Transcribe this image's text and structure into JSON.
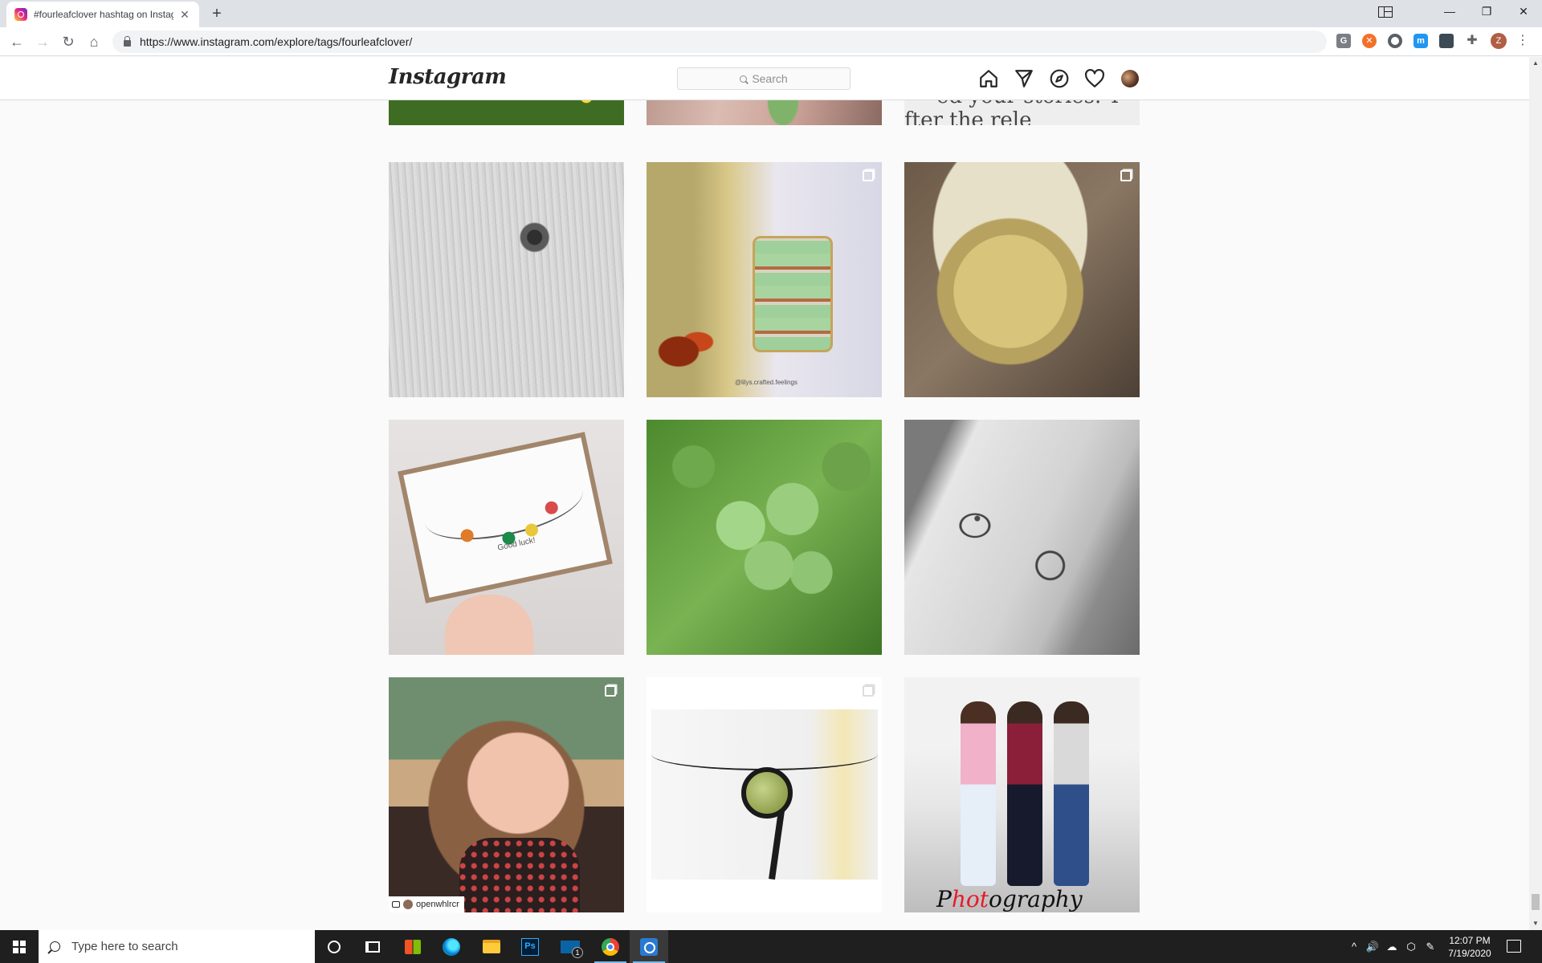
{
  "browser": {
    "tab_title": "#fourleafclover hashtag on Instagram",
    "tab_close_glyph": "✕",
    "new_tab_glyph": "+",
    "url": "https://www.instagram.com/explore/tags/fourleafclover/",
    "profile_initial": "Z",
    "extensions": [
      "grammarly-icon",
      "orange-x-icon",
      "circle-icon",
      "m-icon",
      "mobile-icon",
      "puzzle-icon"
    ],
    "window_controls": {
      "minimize": "—",
      "restore": "❐",
      "close": "✕"
    },
    "nav_glyphs": {
      "back": "←",
      "forward": "→",
      "reload": "↻",
      "home": "⌂",
      "menu": "⋮"
    }
  },
  "instagram": {
    "logo": "Instagram",
    "search_placeholder": "Search",
    "nav_icons": [
      "home-icon",
      "direct-icon",
      "explore-icon",
      "activity-heart-icon",
      "profile-avatar"
    ]
  },
  "posts": [
    {
      "row": 0,
      "col": 0,
      "subject": "yellow flowers in clover",
      "multi": false
    },
    {
      "row": 0,
      "col": 1,
      "subject": "hand holding clover",
      "multi": false
    },
    {
      "row": 0,
      "col": 2,
      "subject": "text post",
      "text_lines": [
        "ed your stories. T",
        "fter the rele"
      ],
      "multi": false
    },
    {
      "row": 1,
      "col": 0,
      "subject": "black and white clover on wood",
      "multi": false
    },
    {
      "row": 1,
      "col": 1,
      "subject": "decorated glass jar",
      "caption": "@lilys.crafted.feelings",
      "multi": true
    },
    {
      "row": 1,
      "col": 2,
      "subject": "glass mug of tea",
      "multi": true
    },
    {
      "row": 2,
      "col": 0,
      "subject": "good luck card",
      "card_text": "Good luck!",
      "multi": false
    },
    {
      "row": 2,
      "col": 1,
      "subject": "four leaf clover in grass",
      "multi": false
    },
    {
      "row": 2,
      "col": 2,
      "subject": "clover tattoos",
      "multi": false
    },
    {
      "row": 3,
      "col": 0,
      "subject": "selfie portrait",
      "repost_user": "openwhlrcr",
      "multi": true
    },
    {
      "row": 3,
      "col": 1,
      "subject": "macrame pendant necklace",
      "multi": true
    },
    {
      "row": 3,
      "col": 2,
      "subject": "three young men posing",
      "brand_pre": "P",
      "brand_hot": "hot",
      "brand_post": "ography",
      "multi": false
    }
  ],
  "taskbar": {
    "search_placeholder": "Type here to search",
    "apps": [
      "cortana-icon",
      "task-view-icon",
      "store-icon",
      "edge-icon",
      "file-explorer-icon",
      "photoshop-icon",
      "mail-icon",
      "chrome-icon",
      "snip-tool-icon"
    ],
    "photoshop_label": "Ps",
    "mail_badge": "1",
    "clock_time": "12:07 PM",
    "clock_date": "7/19/2020",
    "tray_glyphs": {
      "chevron": "^",
      "volume": "🔊",
      "cloud": "☁",
      "dropbox": "⬡",
      "pen": "✎"
    }
  },
  "colors": {
    "ig_text": "#262626",
    "ig_border": "#dbdbdb",
    "taskbar_bg": "#1f1f1f",
    "chrome_tab_strip": "#dee1e6"
  }
}
